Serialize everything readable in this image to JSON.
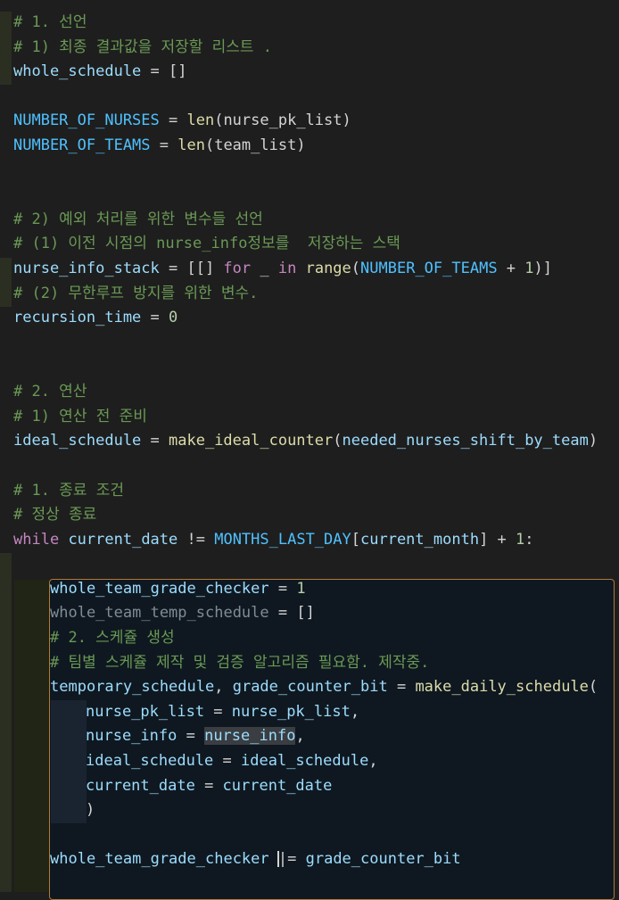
{
  "code": {
    "c1": "# 1. 선언",
    "c2": "# 1) 최종 결과값을 저장할 리스트 .",
    "l3_var": "whole_schedule",
    "l3_rest": " = []",
    "l5_const": "NUMBER_OF_NURSES",
    "l5_eq": " = ",
    "l5_fn": "len",
    "l5_arg": "(nurse_pk_list)",
    "l6_const": "NUMBER_OF_TEAMS",
    "l6_eq": " = ",
    "l6_fn": "len",
    "l6_arg": "(team_list)",
    "c9": "# 2) 예외 처리를 위한 변수들 선언",
    "c10": "# (1) 이전 시점의 nurse_info정보를  저장하는 스택",
    "l11_var": "nurse_info_stack",
    "l11_a": " = [[] ",
    "l11_for": "for",
    "l11_b": " _ ",
    "l11_in": "in",
    "l11_c": " ",
    "l11_range": "range",
    "l11_d": "(",
    "l11_const": "NUMBER_OF_TEAMS",
    "l11_e": " + ",
    "l11_num": "1",
    "l11_f": ")]",
    "c12": "# (2) 무한루프 방지를 위한 변수.",
    "l13_var": "recursion_time",
    "l13_eq": " = ",
    "l13_num": "0",
    "c16": "# 2. 연산",
    "c17": "# 1) 연산 전 준비",
    "l18_var": "ideal_schedule",
    "l18_eq": " = ",
    "l18_fn": "make_ideal_counter",
    "l18_p1": "(",
    "l18_arg": "needed_nurses_shift_by_team",
    "l18_p2": ")",
    "c20": "# 1. 종료 조건",
    "c21": "# 정상 종료",
    "l22_kw": "while",
    "l22_a": " ",
    "l22_var": "current_date",
    "l22_b": " != ",
    "l22_const": "MONTHS_LAST_DAY",
    "l22_c": "[",
    "l22_var2": "current_month",
    "l22_d": "] + ",
    "l22_num": "1",
    "l22_e": ":",
    "l24_var": "whole_team_grade_checker",
    "l24_eq": " = ",
    "l24_num": "1",
    "l25_var": "whole_team_temp_schedule",
    "l25_rest": " = []",
    "c26": "# 2. 스케쥴 생성",
    "c27": "# 팀별 스케쥴 제작 및 검증 알고리즘 필요함. 제작중.",
    "l28_var1": "temporary_schedule",
    "l28_a": ", ",
    "l28_var2": "grade_counter_bit",
    "l28_b": " = ",
    "l28_fn": "make_daily_schedule",
    "l28_c": "(",
    "l29_var1": "nurse_pk_list",
    "l29_a": " = ",
    "l29_var2": "nurse_pk_list",
    "l29_b": ",",
    "l30_var1": "nurse_info",
    "l30_a": " = ",
    "l30_var2": "nurse_info",
    "l30_b": ",",
    "l31_var1": "ideal_schedule",
    "l31_a": " = ",
    "l31_var2": "ideal_schedule",
    "l31_b": ",",
    "l32_var1": "current_date",
    "l32_a": " = ",
    "l32_var2": "current_date",
    "l33": ")",
    "l35_var1": "whole_team_grade_checker",
    "l35_a": " ",
    "l35_b": "|= ",
    "l35_var2": "grade_counter_bit"
  }
}
